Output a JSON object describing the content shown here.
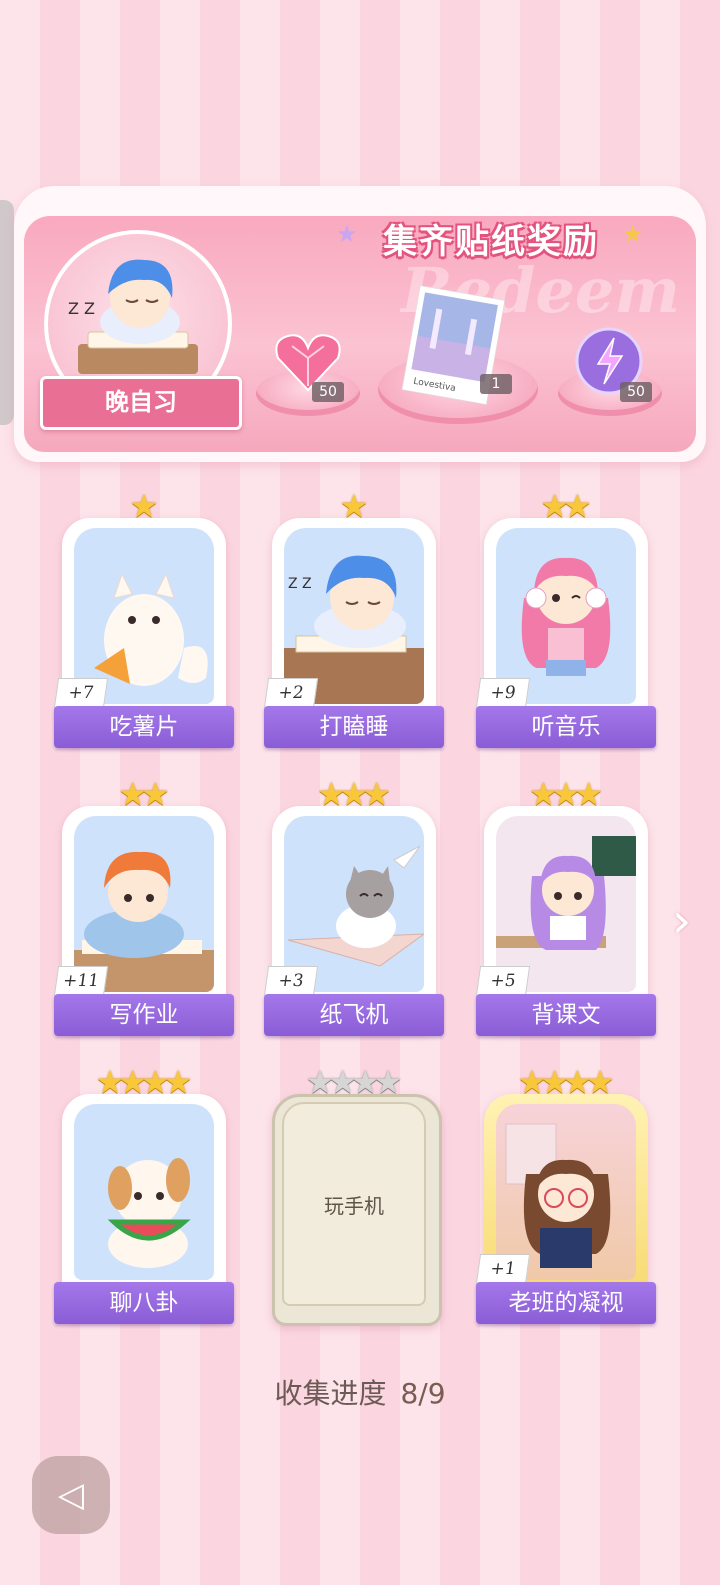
{
  "banner": {
    "title": "集齐贴纸奖励",
    "watermark": "Redeem",
    "featured_name": "晚自习",
    "rewards": [
      {
        "icon": "pink-heart-gem-icon",
        "count": "50"
      },
      {
        "icon": "photo-card-icon",
        "count": "1",
        "caption": "Lovestiva"
      },
      {
        "icon": "purple-energy-orb-icon",
        "count": "50"
      }
    ]
  },
  "cards": [
    {
      "name": "吃薯片",
      "bonus": "+7",
      "stars": 1,
      "state": "collected"
    },
    {
      "name": "打瞌睡",
      "bonus": "+2",
      "stars": 1,
      "state": "collected"
    },
    {
      "name": "听音乐",
      "bonus": "+9",
      "stars": 2,
      "state": "collected"
    },
    {
      "name": "写作业",
      "bonus": "+11",
      "stars": 2,
      "state": "collected"
    },
    {
      "name": "纸飞机",
      "bonus": "+3",
      "stars": 3,
      "state": "collected"
    },
    {
      "name": "背课文",
      "bonus": "+5",
      "stars": 3,
      "state": "collected"
    },
    {
      "name": "聊八卦",
      "bonus": "",
      "stars": 4,
      "state": "collected"
    },
    {
      "name": "玩手机",
      "bonus": "",
      "stars": 4,
      "state": "locked"
    },
    {
      "name": "老班的凝视",
      "bonus": "+1",
      "stars": 4,
      "state": "golden"
    }
  ],
  "progress": {
    "label": "收集进度",
    "value": "8/9"
  },
  "colors": {
    "label_purple": "#9467df",
    "banner_pink": "#f9a9bf",
    "star_gold": "#f8c83a"
  }
}
